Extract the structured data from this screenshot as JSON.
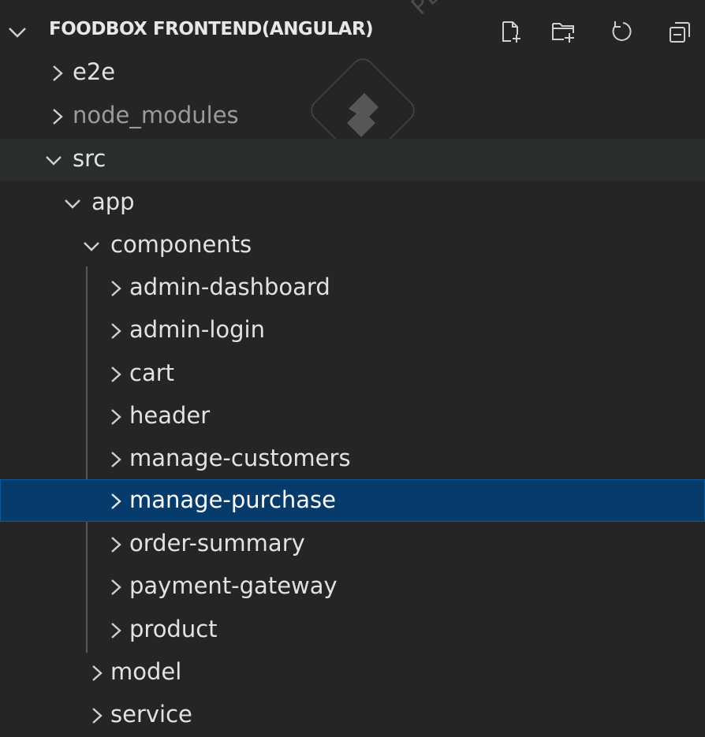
{
  "explorer": {
    "title": "FOODBOX FRONTEND(ANGULAR)",
    "actions": [
      {
        "name": "new-file-icon"
      },
      {
        "name": "new-folder-icon"
      },
      {
        "name": "refresh-icon"
      },
      {
        "name": "collapse-all-icon"
      }
    ]
  },
  "tree": [
    {
      "label": "e2e",
      "expanded": false
    },
    {
      "label": "node_modules",
      "expanded": false
    },
    {
      "label": "src",
      "expanded": true
    },
    {
      "label": "app",
      "expanded": true
    },
    {
      "label": "components",
      "expanded": true
    },
    {
      "label": "admin-dashboard",
      "expanded": false
    },
    {
      "label": "admin-login",
      "expanded": false
    },
    {
      "label": "cart",
      "expanded": false
    },
    {
      "label": "header",
      "expanded": false
    },
    {
      "label": "manage-customers",
      "expanded": false
    },
    {
      "label": "manage-purchase",
      "expanded": false,
      "selected": true
    },
    {
      "label": "order-summary",
      "expanded": false
    },
    {
      "label": "payment-gateway",
      "expanded": false
    },
    {
      "label": "product",
      "expanded": false
    },
    {
      "label": "model",
      "expanded": false
    },
    {
      "label": "service",
      "expanded": false
    }
  ],
  "watermark": {
    "text": "PDFele"
  },
  "colors": {
    "background": "#252526",
    "selected": "#063b6b",
    "hover": "#2a2d2e",
    "text": "#e2e2e2"
  }
}
